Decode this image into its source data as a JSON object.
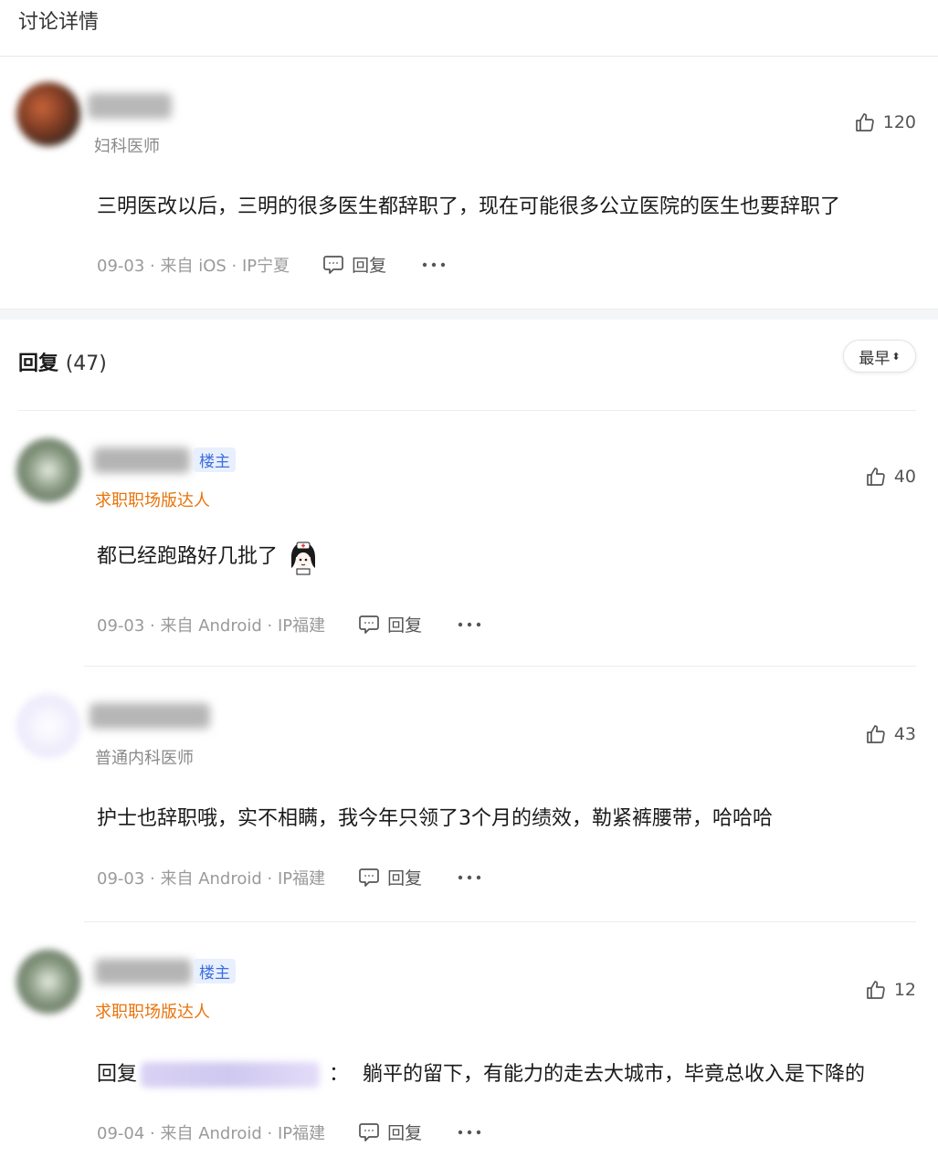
{
  "page": {
    "title": "讨论详情"
  },
  "main_post": {
    "role": "妇科医师",
    "likes": "120",
    "content": "三明医改以后，三明的很多医生都辞职了，现在可能很多公立医院的医生也要辞职了",
    "meta": "09-03 · 来自 iOS · IP宁夏",
    "reply_label": "回复"
  },
  "replies_header": {
    "title": "回复",
    "count": "(47)",
    "sort_label": "最早"
  },
  "replies": [
    {
      "badge": "楼主",
      "role": "求职职场版达人",
      "likes": "40",
      "content": "都已经跑路好几批了",
      "meta": "09-03 · 来自 Android · IP福建",
      "reply_label": "回复"
    },
    {
      "role": "普通内科医师",
      "likes": "43",
      "content": "护士也辞职哦，实不相瞒，我今年只领了3个月的绩效，勒紧裤腰带，哈哈哈",
      "meta": "09-03 · 来自 Android · IP福建",
      "reply_label": "回复"
    },
    {
      "badge": "楼主",
      "role": "求职职场版达人",
      "likes": "12",
      "content_prefix": "回复",
      "content_colon": "：",
      "content": "躺平的留下，有能力的走去大城市，毕竟总收入是下降的",
      "meta": "09-04 · 来自 Android · IP福建",
      "reply_label": "回复"
    }
  ],
  "icons": {
    "like": "thumbs-up-icon",
    "reply": "comment-icon",
    "more": "more-dots-icon",
    "sort": "sort-caret-icon"
  },
  "colors": {
    "orange_role": "#e8740c",
    "badge_blue": "#3c6ee0",
    "meta_gray": "#9a9a9a"
  }
}
